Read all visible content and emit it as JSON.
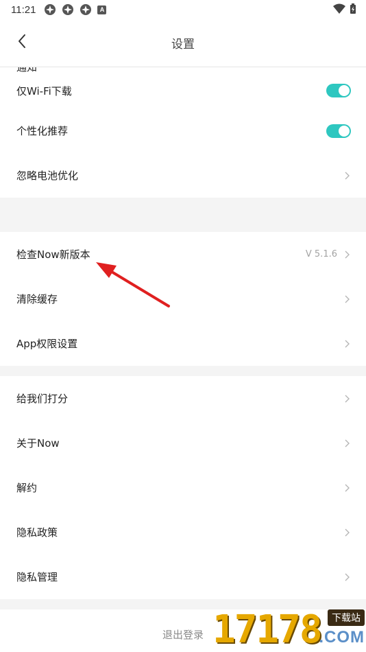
{
  "status_bar": {
    "time": "11:21",
    "right_icon": "A"
  },
  "nav": {
    "title": "设置"
  },
  "partial_row": {
    "label": "通知"
  },
  "group1": [
    {
      "label": "仅Wi-Fi下载",
      "control": "toggle",
      "toggle_on": true
    },
    {
      "label": "个性化推荐",
      "control": "toggle",
      "toggle_on": true
    },
    {
      "label": "忽略电池优化",
      "control": "chevron"
    }
  ],
  "group2": [
    {
      "label": "检查Now新版本",
      "value": "V 5.1.6",
      "control": "chevron"
    },
    {
      "label": "清除缓存",
      "control": "chevron"
    },
    {
      "label": "App权限设置",
      "control": "chevron"
    }
  ],
  "group3": [
    {
      "label": "给我们打分",
      "control": "chevron"
    },
    {
      "label": "关于Now",
      "control": "chevron"
    },
    {
      "label": "解约",
      "control": "chevron"
    },
    {
      "label": "隐私政策",
      "control": "chevron"
    },
    {
      "label": "隐私管理",
      "control": "chevron"
    }
  ],
  "logout": {
    "label": "退出登录"
  },
  "watermark": {
    "digits": "17178",
    "badge": "下载站",
    "com": ".COM"
  },
  "colors": {
    "toggle_on": "#2ec7c0",
    "annotation_arrow": "#e02020"
  }
}
